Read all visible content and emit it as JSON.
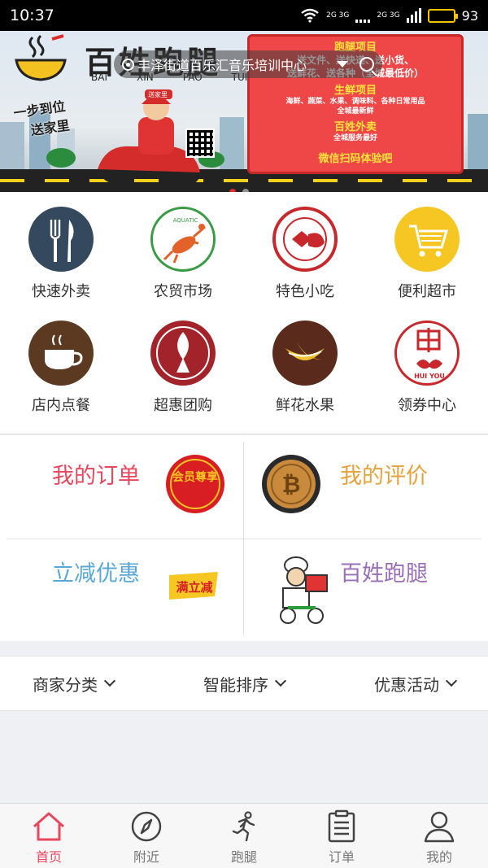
{
  "status_bar": {
    "time": "10:37",
    "battery": "93",
    "battery_level": 0.93,
    "net_tag_1": "2G 3G",
    "net_tag_2": "2G 3G"
  },
  "banner": {
    "brand_title": "百姓跑腿",
    "brand_pinyin": [
      "BAI",
      "XIN",
      "PAO",
      "TUI"
    ],
    "slogan": [
      "一步到位",
      "送家里"
    ],
    "courier_badge": "送家里",
    "location": "丰泽街道百乐汇音乐培训中心",
    "promo": {
      "h1": "跑腿项目",
      "l1": "送文件、送快递、送小货、",
      "l2": "送鲜花、送各种（全城最低价）",
      "h2": "生鲜项目",
      "l3": "海鲜、蔬菜、水果、调味料、各种日常用品",
      "l4": "全城最新鲜",
      "h3": "百姓外卖",
      "l5": "全城服务最好",
      "btm": "微信扫码体验吧"
    },
    "accent": "#ef4748"
  },
  "categories": [
    {
      "label": "快速外卖",
      "icon": "fork-knife-icon"
    },
    {
      "label": "农贸市场",
      "icon": "lobster-icon"
    },
    {
      "label": "特色小吃",
      "icon": "chi-snack-icon"
    },
    {
      "label": "便利超市",
      "icon": "shopping-cart-icon"
    },
    {
      "label": "店内点餐",
      "icon": "coffee-cup-icon"
    },
    {
      "label": "超惠团购",
      "icon": "fish-icon"
    },
    {
      "label": "鲜花水果",
      "icon": "banana-icon"
    },
    {
      "label": "领券中心",
      "icon": "hui-coupon-icon"
    }
  ],
  "category_extra": {
    "market_badge": "AQUATIC",
    "coupon_text": "HUI YOU"
  },
  "quick": {
    "my_orders": "我的订单",
    "my_reviews": "我的评价",
    "instant_discount": "立减优惠",
    "errand": "百姓跑腿",
    "vip_badge": "会员尊享",
    "discount_badge": "满立减",
    "colors": {
      "orders": "#e8475e",
      "reviews": "#e8a23c",
      "discount": "#5aa8d6",
      "errand": "#9a6fb8"
    }
  },
  "filters": [
    "商家分类",
    "智能排序",
    "优惠活动"
  ],
  "tabs": [
    {
      "label": "首页",
      "icon": "home-icon",
      "active": true
    },
    {
      "label": "附近",
      "icon": "compass-icon",
      "active": false
    },
    {
      "label": "跑腿",
      "icon": "runner-icon",
      "active": false
    },
    {
      "label": "订单",
      "icon": "order-list-icon",
      "active": false
    },
    {
      "label": "我的",
      "icon": "profile-icon",
      "active": false
    }
  ]
}
